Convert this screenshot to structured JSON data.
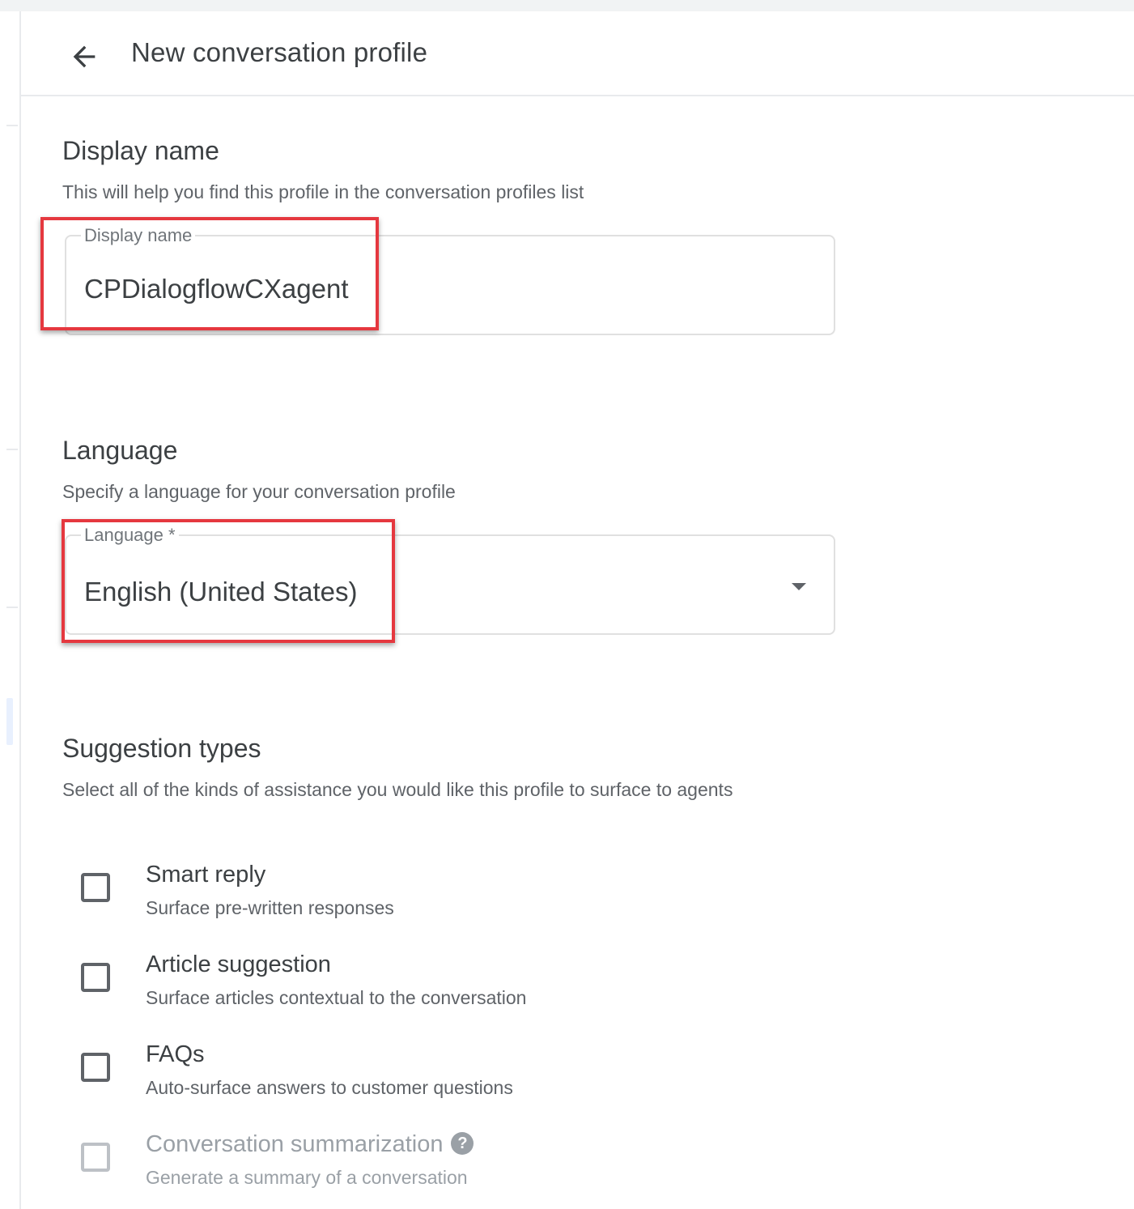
{
  "header": {
    "back_icon": "arrow-back-icon",
    "title": "New conversation profile"
  },
  "display_name_section": {
    "title": "Display name",
    "description": "This will help you find this profile in the conversation profiles list",
    "field_label": "Display name",
    "field_value": "CPDialogflowCXagent"
  },
  "language_section": {
    "title": "Language",
    "description": "Specify a language for your conversation profile",
    "field_label": "Language *",
    "selected_value": "English (United States)",
    "dropdown_icon": "arrow-drop-down-icon"
  },
  "suggestion_section": {
    "title": "Suggestion types",
    "description": "Select all of the kinds of assistance you would like this profile to surface to agents",
    "options": [
      {
        "label": "Smart reply",
        "description": "Surface pre-written responses",
        "checked": false,
        "disabled": false
      },
      {
        "label": "Article suggestion",
        "description": "Surface articles contextual to the conversation",
        "checked": false,
        "disabled": false
      },
      {
        "label": "FAQs",
        "description": "Auto-surface answers to customer questions",
        "checked": false,
        "disabled": false
      },
      {
        "label": "Conversation summarization",
        "description": "Generate a summary of a conversation",
        "checked": false,
        "disabled": true,
        "help_icon": "help-icon",
        "help_glyph": "?"
      }
    ]
  },
  "colors": {
    "highlight": "#e5383f",
    "text_primary": "#3c4043",
    "text_secondary": "#5f6368",
    "disabled": "#9aa0a6"
  }
}
